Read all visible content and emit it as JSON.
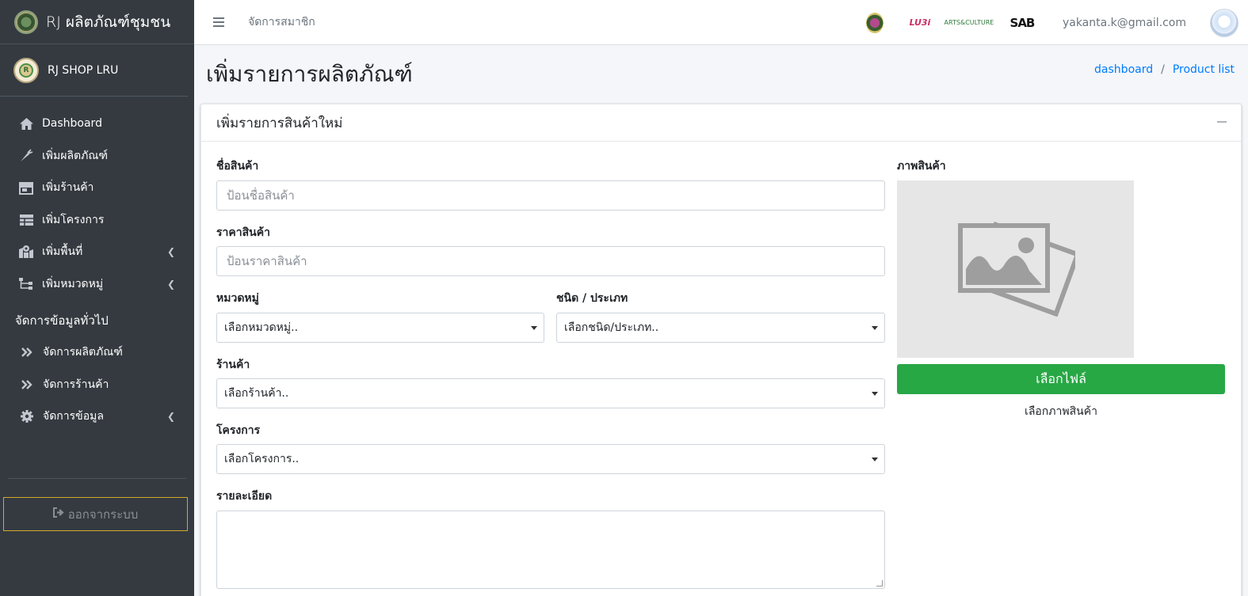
{
  "brand": {
    "title": "RJ ผลิตภัณฑ์ชุมชน"
  },
  "user": {
    "name": "RJ SHOP LRU",
    "avatar_text": "R"
  },
  "sidebar": {
    "items": [
      {
        "label": "Dashboard",
        "icon": "home-icon"
      },
      {
        "label": "เพิ่มผลิตภัณฑ์",
        "icon": "carrot-icon"
      },
      {
        "label": "เพิ่มร้านค้า",
        "icon": "store-icon"
      },
      {
        "label": "เพิ่มโครงการ",
        "icon": "table-icon"
      },
      {
        "label": "เพิ่มพื้นที่",
        "icon": "map-marked-icon",
        "has_children": true
      },
      {
        "label": "เพิ่มหมวดหมู่",
        "icon": "sitemap-icon",
        "has_children": true
      }
    ],
    "section_header": "จัดการข้อมูลทั่วไป",
    "sub_items": [
      {
        "label": "จัดการผลิตภัณฑ์",
        "icon": "double-chevron-right-icon"
      },
      {
        "label": "จัดการร้านค้า",
        "icon": "double-chevron-right-icon"
      },
      {
        "label": "จัดการข้อมูล",
        "icon": "gear-icon",
        "has_children": true
      }
    ],
    "logout_label": "ออกจากระบบ"
  },
  "topbar": {
    "manage_members": "จัดการสมาชิก",
    "logo2_text": "LU3i",
    "logo3_text": "ARTS&CULTURE",
    "logo4_text": "SAB",
    "email": "yakanta.k@gmail.com"
  },
  "page": {
    "title": "เพิ่มรายการผลิตภัณฑ์",
    "breadcrumb": [
      "dashboard",
      "Product list"
    ]
  },
  "card": {
    "title": "เพิ่มรายการสินค้าใหม่",
    "fields": {
      "name_label": "ชื่อสินค้า",
      "name_placeholder": "ป้อนชื่อสินค้า",
      "price_label": "ราคาสินค้า",
      "price_placeholder": "ป้อนราคาสินค้า",
      "category_label": "หมวดหมู่",
      "category_value": "เลือกหมวดหมู่..",
      "type_label": "ชนิด / ประเภท",
      "type_value": "เลือกชนิด/ประเภท..",
      "shop_label": "ร้านค้า",
      "shop_value": "เลือกร้านค้า..",
      "project_label": "โครงการ",
      "project_value": "เลือกโครงการ..",
      "detail_label": "รายละเอียด"
    },
    "image": {
      "label": "ภาพสินค้า",
      "button": "เลือกไฟล์",
      "caption": "เลือกภาพสินค้า"
    }
  },
  "colors": {
    "sidebar_bg": "#343a40",
    "accent_link": "#007bff",
    "file_button": "#28a745",
    "logout_border": "#d4a92b"
  }
}
